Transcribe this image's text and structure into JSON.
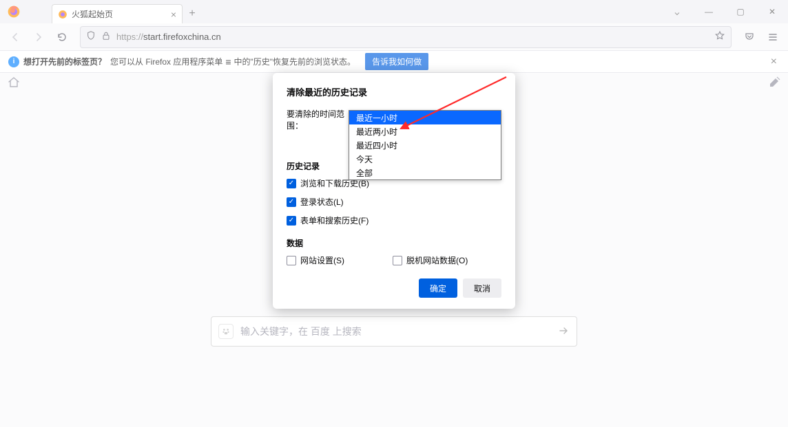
{
  "tab": {
    "title": "火狐起始页"
  },
  "url": {
    "protocol": "https://",
    "host": "start.firefoxchina.cn"
  },
  "infobar": {
    "strong": "想打开先前的标签页？",
    "text1": "您可以从 Firefox 应用程序菜单",
    "text2": "中的\"历史\"恢复先前的浏览状态。",
    "button": "告诉我如何做"
  },
  "search": {
    "placeholder": "输入关键字，在 百度 上搜索"
  },
  "dialog": {
    "title": "清除最近的历史记录",
    "range_label": "要清除的时间范围：",
    "combo_value": "最近一小时",
    "options": [
      "最近一小时",
      "最近两小时",
      "最近四小时",
      "今天",
      "全部"
    ],
    "section_history": "历史记录",
    "chk_browse": "浏览和下载历史(B)",
    "chk_login": "登录状态(L)",
    "chk_form": "表单和搜索历史(F)",
    "section_data": "数据",
    "chk_site": "网站设置(S)",
    "chk_offline": "脱机网站数据(O)",
    "ok": "确定",
    "cancel": "取消"
  }
}
